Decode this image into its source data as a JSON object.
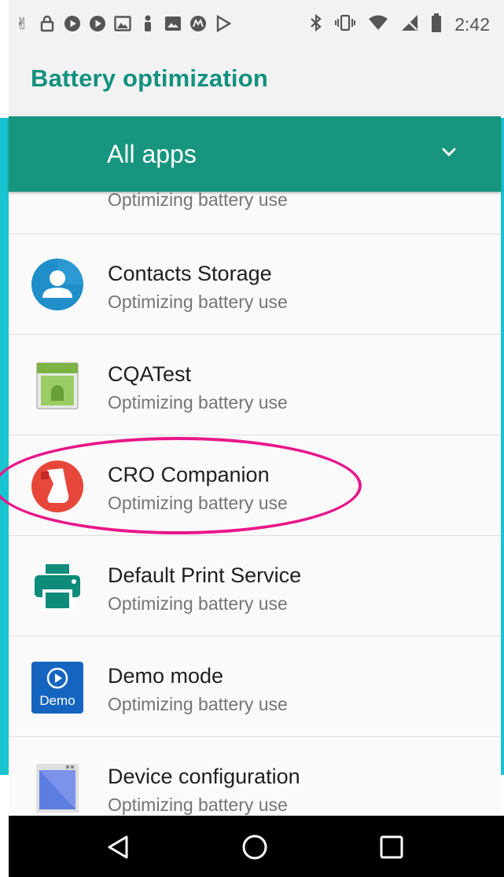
{
  "status_bar": {
    "time": "2:42",
    "left_icons": [
      "hands-icon",
      "lock-icon",
      "play-circle-icon",
      "play-circle-icon",
      "photo-icon",
      "person-icon",
      "image-icon",
      "motorola-icon",
      "play-store-icon"
    ],
    "right_icons": [
      "bluetooth-icon",
      "vibrate-icon",
      "wifi-icon",
      "no-signal-icon",
      "battery-icon"
    ]
  },
  "app_bar": {
    "title": "Battery optimization"
  },
  "filter": {
    "selected": "All apps",
    "icon": "chevron-down-icon"
  },
  "apps": [
    {
      "name": "",
      "status": "Optimizing battery use",
      "icon": "app-icon"
    },
    {
      "name": "Contacts Storage",
      "status": "Optimizing battery use",
      "icon": "contacts-storage-icon"
    },
    {
      "name": "CQATest",
      "status": "Optimizing battery use",
      "icon": "cqatest-icon"
    },
    {
      "name": "CRO Companion",
      "status": "Optimizing battery use",
      "icon": "cro-companion-icon"
    },
    {
      "name": "Default Print Service",
      "status": "Optimizing battery use",
      "icon": "printer-icon"
    },
    {
      "name": "Demo mode",
      "status": "Optimizing battery use",
      "icon": "demo-mode-icon",
      "icon_label": "Demo"
    },
    {
      "name": "Device configuration",
      "status": "Optimizing battery use",
      "icon": "device-configuration-icon"
    }
  ],
  "nav_bar": {
    "buttons": [
      "back-icon",
      "home-icon",
      "recents-icon"
    ]
  },
  "colors": {
    "accent": "#13917f",
    "header_bg": "#17957f",
    "highlight": "#e8178a",
    "frame": "#17c3cf"
  }
}
